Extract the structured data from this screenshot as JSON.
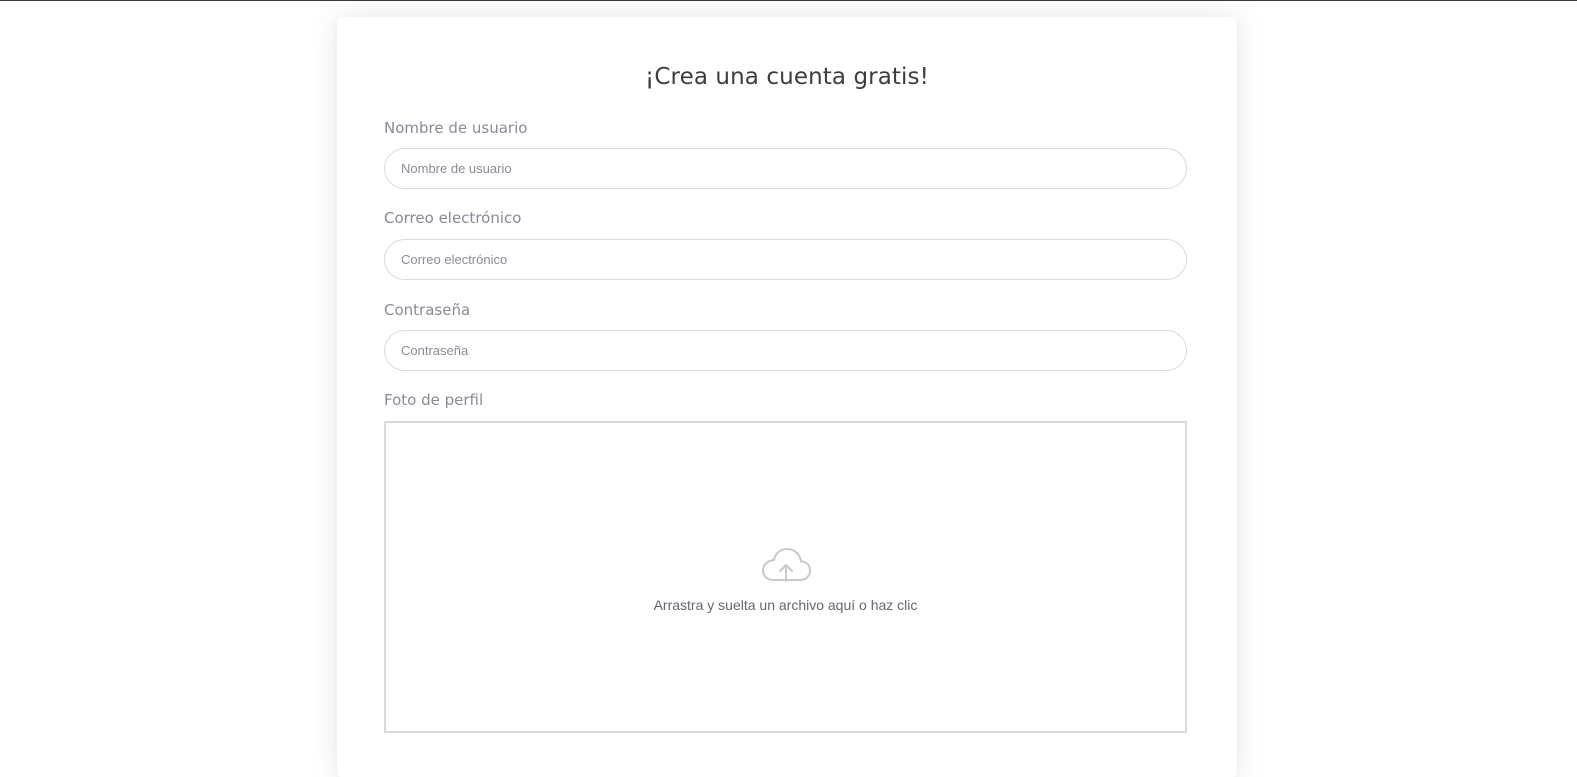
{
  "form": {
    "title": "¡Crea una cuenta gratis!",
    "username": {
      "label": "Nombre de usuario",
      "placeholder": "Nombre de usuario",
      "value": ""
    },
    "email": {
      "label": "Correo electrónico",
      "placeholder": "Correo electrónico",
      "value": ""
    },
    "password": {
      "label": "Contraseña",
      "placeholder": "Contraseña",
      "value": ""
    },
    "profile_photo": {
      "label": "Foto de perfil",
      "dropzone_text": "Arrastra y suelta un archivo aquí o haz clic",
      "icon": "cloud-upload-icon"
    }
  },
  "colors": {
    "title": "#3d3d3d",
    "label": "#8a8a96",
    "input_border": "#d9d9de",
    "dropzone_border": "#dadada",
    "icon": "#c8c8cc"
  }
}
